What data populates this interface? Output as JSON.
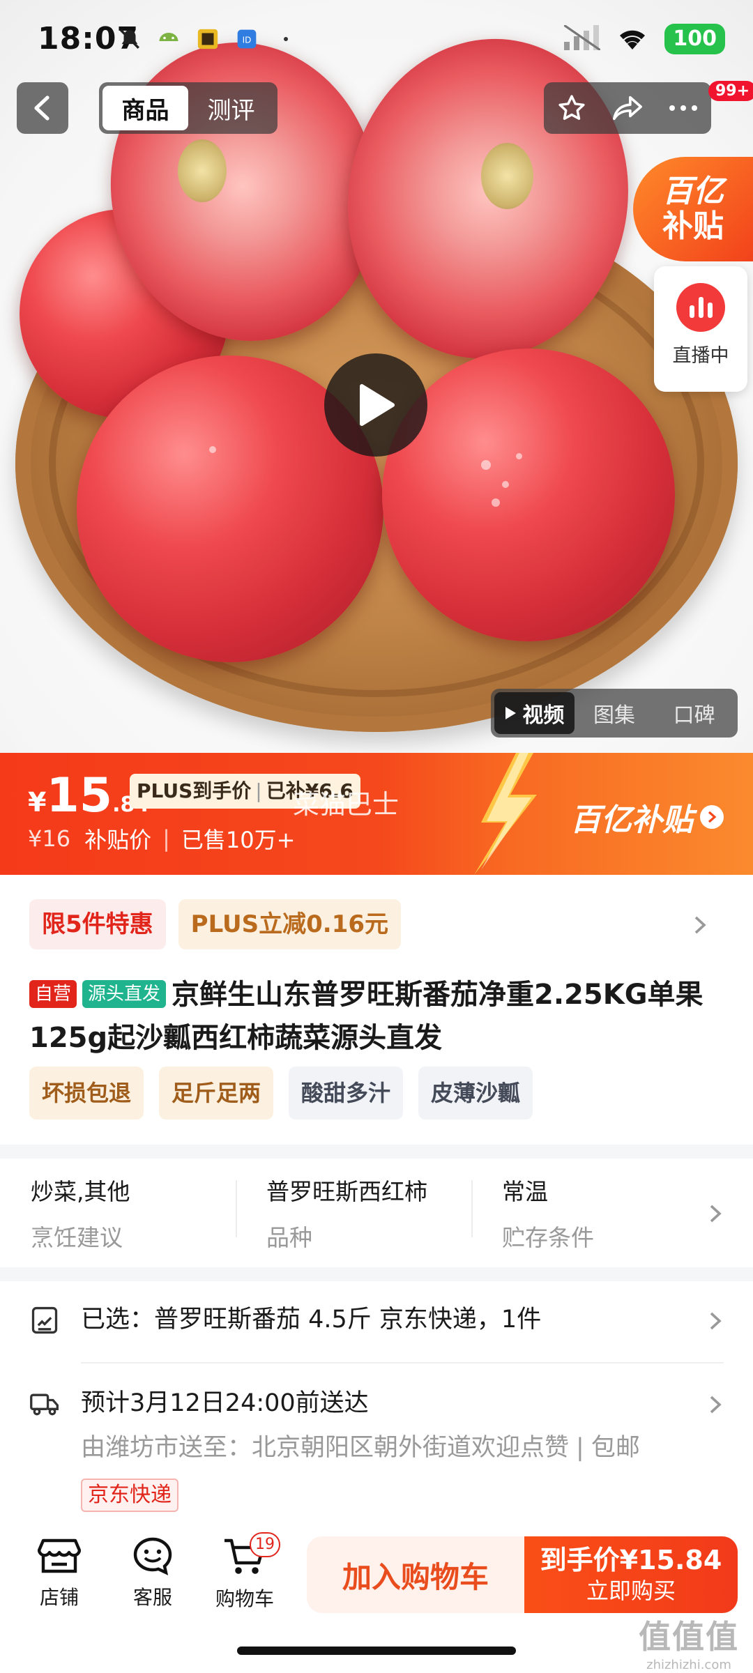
{
  "status_bar": {
    "time": "18:07",
    "battery": "100"
  },
  "nav": {
    "tabs": [
      {
        "label": "商品",
        "active": true
      },
      {
        "label": "测评",
        "active": false
      }
    ],
    "message_badge": "99+"
  },
  "hero": {
    "subsidy_corner": {
      "line1": "百亿",
      "line2": "补贴"
    },
    "live_label": "直播中",
    "media_tabs": [
      {
        "label": "视频",
        "active": true
      },
      {
        "label": "图集",
        "active": false
      },
      {
        "label": "口碑",
        "active": false
      }
    ]
  },
  "price": {
    "currency": "¥",
    "integer": "15",
    "decimal": ".84",
    "plus_tag_a": "PLUS到手价",
    "plus_tag_b": "已补¥6.6",
    "watermark": "菜猫巴士",
    "original": "¥16",
    "label": "补贴价",
    "sold": "已售10万+",
    "subsidy_banner": "百亿补贴"
  },
  "promos": [
    "限5件特惠",
    "PLUS立减0.16元"
  ],
  "product": {
    "tag_self": "自营",
    "tag_origin": "源头直发",
    "title": "京鲜生山东普罗旺斯番茄净重2.25KG单果125g起沙瓤西红柿蔬菜源头直发",
    "features": [
      "坏损包退",
      "足斤足两",
      "酸甜多汁",
      "皮薄沙瓤"
    ]
  },
  "attributes": [
    {
      "value": "炒菜,其他",
      "key": "烹饪建议"
    },
    {
      "value": "普罗旺斯西红柿",
      "key": "品种"
    },
    {
      "value": "常温",
      "key": "贮存条件"
    }
  ],
  "selection": {
    "label": "已选：",
    "value": "普罗旺斯番茄 4.5斤 京东快递，1件"
  },
  "delivery": {
    "eta": "预计3月12日24:00前送达",
    "from_label": "由潍坊市送至：",
    "address": "北京朝阳区朝外街道欢迎点赞",
    "shipping": "包邮",
    "carrier": "京东快递"
  },
  "bottom_bar": {
    "shop": "店铺",
    "service": "客服",
    "cart": "购物车",
    "cart_count": "19",
    "add_to_cart": "加入购物车",
    "buy_price": "到手价¥15.84",
    "buy_now": "立即购买"
  },
  "corner_watermark": {
    "big": "值值值",
    "small": "zhizhizhi.com"
  },
  "colors": {
    "jd_red": "#e1251b",
    "subsidy_orange": "#f5481c",
    "origin_green": "#1fb48e"
  }
}
